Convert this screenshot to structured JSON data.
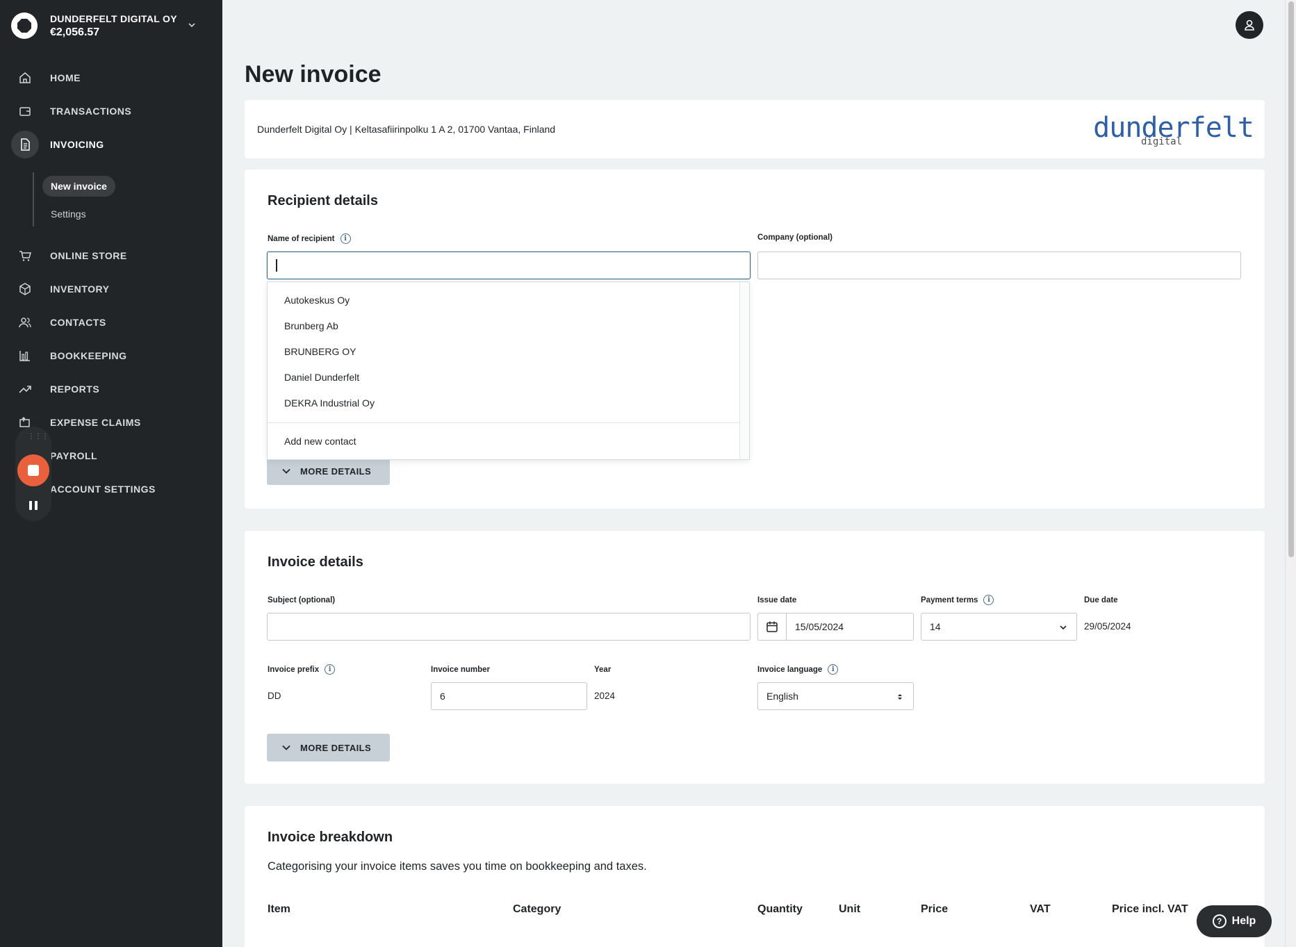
{
  "colors": {
    "sidebar_bg": "#222527",
    "accent_focus": "#3c6d8a",
    "record_button": "#e9603c",
    "brand_blue": "#2f5fa6",
    "page_bg": "#eef2f3"
  },
  "company": {
    "name": "DUNDERFELT DIGITAL OY",
    "balance": "€2,056.57",
    "icon": "company-logo",
    "chevron": "chevron-down-icon"
  },
  "nav": [
    {
      "label": "HOME",
      "icon": "home-icon"
    },
    {
      "label": "TRANSACTIONS",
      "icon": "wallet-icon"
    },
    {
      "label": "INVOICING",
      "icon": "document-icon",
      "active": true
    },
    {
      "label": "ONLINE STORE",
      "icon": "cart-icon"
    },
    {
      "label": "INVENTORY",
      "icon": "box-icon"
    },
    {
      "label": "CONTACTS",
      "icon": "people-icon"
    },
    {
      "label": "BOOKKEEPING",
      "icon": "bar-chart-icon"
    },
    {
      "label": "REPORTS",
      "icon": "trend-icon"
    },
    {
      "label": "EXPENSE CLAIMS",
      "icon": "receipt-icon"
    },
    {
      "label": "PAYROLL",
      "icon": "payroll-icon"
    },
    {
      "label": "ACCOUNT SETTINGS",
      "icon": "settings-icon"
    }
  ],
  "subnav": [
    {
      "label": "New invoice",
      "active": true
    },
    {
      "label": "Settings"
    }
  ],
  "page": {
    "title": "New invoice"
  },
  "sender": {
    "address": "Dunderfelt Digital Oy | Keltasafiirinpolku 1 A 2, 01700 Vantaa, Finland",
    "logo_main": "dunderfelt",
    "logo_sub": "digital"
  },
  "recipient": {
    "title": "Recipient details",
    "name_label": "Name of recipient",
    "name_value": "",
    "company_label": "Company (optional)",
    "company_value": "",
    "suggestions": [
      "Autokeskus Oy",
      "Brunberg Ab",
      "BRUNBERG OY",
      "Daniel Dunderfelt",
      "DEKRA Industrial Oy"
    ],
    "add_new": "Add new contact",
    "more_details": "MORE DETAILS"
  },
  "invoice": {
    "title": "Invoice details",
    "subject_label": "Subject (optional)",
    "subject_value": "",
    "issue_date_label": "Issue date",
    "issue_date": "15/05/2024",
    "payment_terms_label": "Payment terms",
    "payment_terms": "14",
    "due_date_label": "Due date",
    "due_date": "29/05/2024",
    "prefix_label": "Invoice prefix",
    "prefix": "DD",
    "number_label": "Invoice number",
    "number": "6",
    "year_label": "Year",
    "year": "2024",
    "language_label": "Invoice language",
    "language": "English",
    "more_details": "MORE DETAILS"
  },
  "breakdown": {
    "title": "Invoice breakdown",
    "description": "Categorising your invoice items saves you time on bookkeeping and taxes.",
    "columns": [
      "Item",
      "Category",
      "Quantity",
      "Unit",
      "Price",
      "VAT",
      "Price incl. VAT"
    ]
  },
  "help": {
    "label": "Help"
  }
}
